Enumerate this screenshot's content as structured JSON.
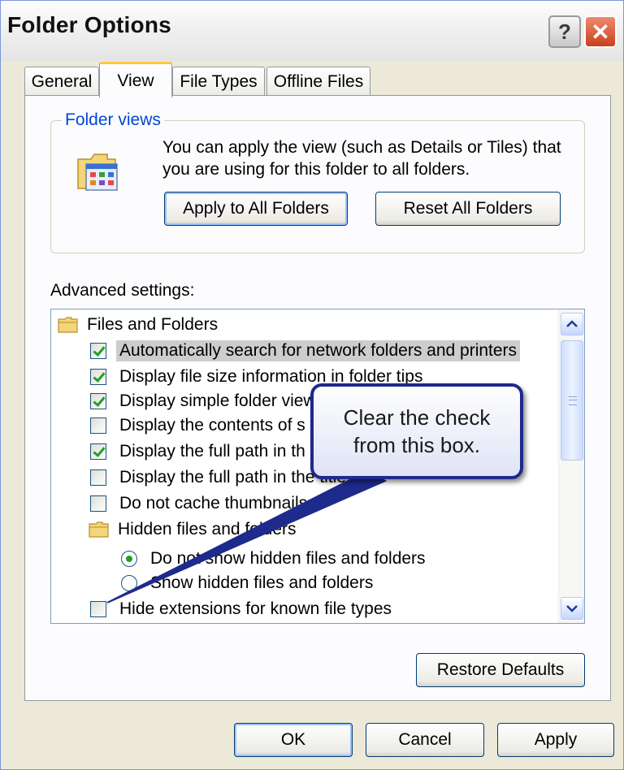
{
  "window": {
    "title": "Folder Options"
  },
  "titlebar": {
    "help_label": "?",
    "close_label": "✕"
  },
  "tabs": [
    {
      "label": "General",
      "active": false
    },
    {
      "label": "View",
      "active": true
    },
    {
      "label": "File Types",
      "active": false
    },
    {
      "label": "Offline Files",
      "active": false
    }
  ],
  "folder_views": {
    "legend": "Folder views",
    "description": "You can apply the view (such as Details or Tiles) that you are using for this folder to all folders.",
    "apply_button": "Apply to All Folders",
    "reset_button": "Reset All Folders",
    "icon": "folder-views-icon"
  },
  "advanced": {
    "label": "Advanced settings:",
    "items": [
      {
        "type": "folder",
        "label": "Files and Folders"
      },
      {
        "type": "checkbox",
        "label": "Automatically search for network folders and printers",
        "checked": true,
        "selected": true
      },
      {
        "type": "checkbox",
        "label": "Display file size information in folder tips",
        "checked": true
      },
      {
        "type": "checkbox",
        "label": "Display simple folder view",
        "checked": true
      },
      {
        "type": "checkbox",
        "label": "Display the contents of s",
        "checked": false
      },
      {
        "type": "checkbox",
        "label": "Display the full path in th",
        "checked": true
      },
      {
        "type": "checkbox",
        "label": "Display the full path in the title",
        "checked": false
      },
      {
        "type": "checkbox",
        "label": "Do not cache thumbnails",
        "checked": false
      },
      {
        "type": "folder",
        "label": "Hidden files and folders"
      },
      {
        "type": "radio",
        "label": "Do not show hidden files and folders",
        "checked": true
      },
      {
        "type": "radio",
        "label": "Show hidden files and folders",
        "checked": false
      },
      {
        "type": "checkbox",
        "label": "Hide extensions for known file types",
        "checked": false
      }
    ]
  },
  "callout": {
    "line1": "Clear the check",
    "line2": "from this box."
  },
  "buttons": {
    "restore_defaults": "Restore Defaults",
    "ok": "OK",
    "cancel": "Cancel",
    "apply": "Apply"
  },
  "colors": {
    "accent": "#0046d5",
    "check": "#21a121",
    "callout_border": "#1e2a8c",
    "tab_highlight": "#ffc83c"
  }
}
